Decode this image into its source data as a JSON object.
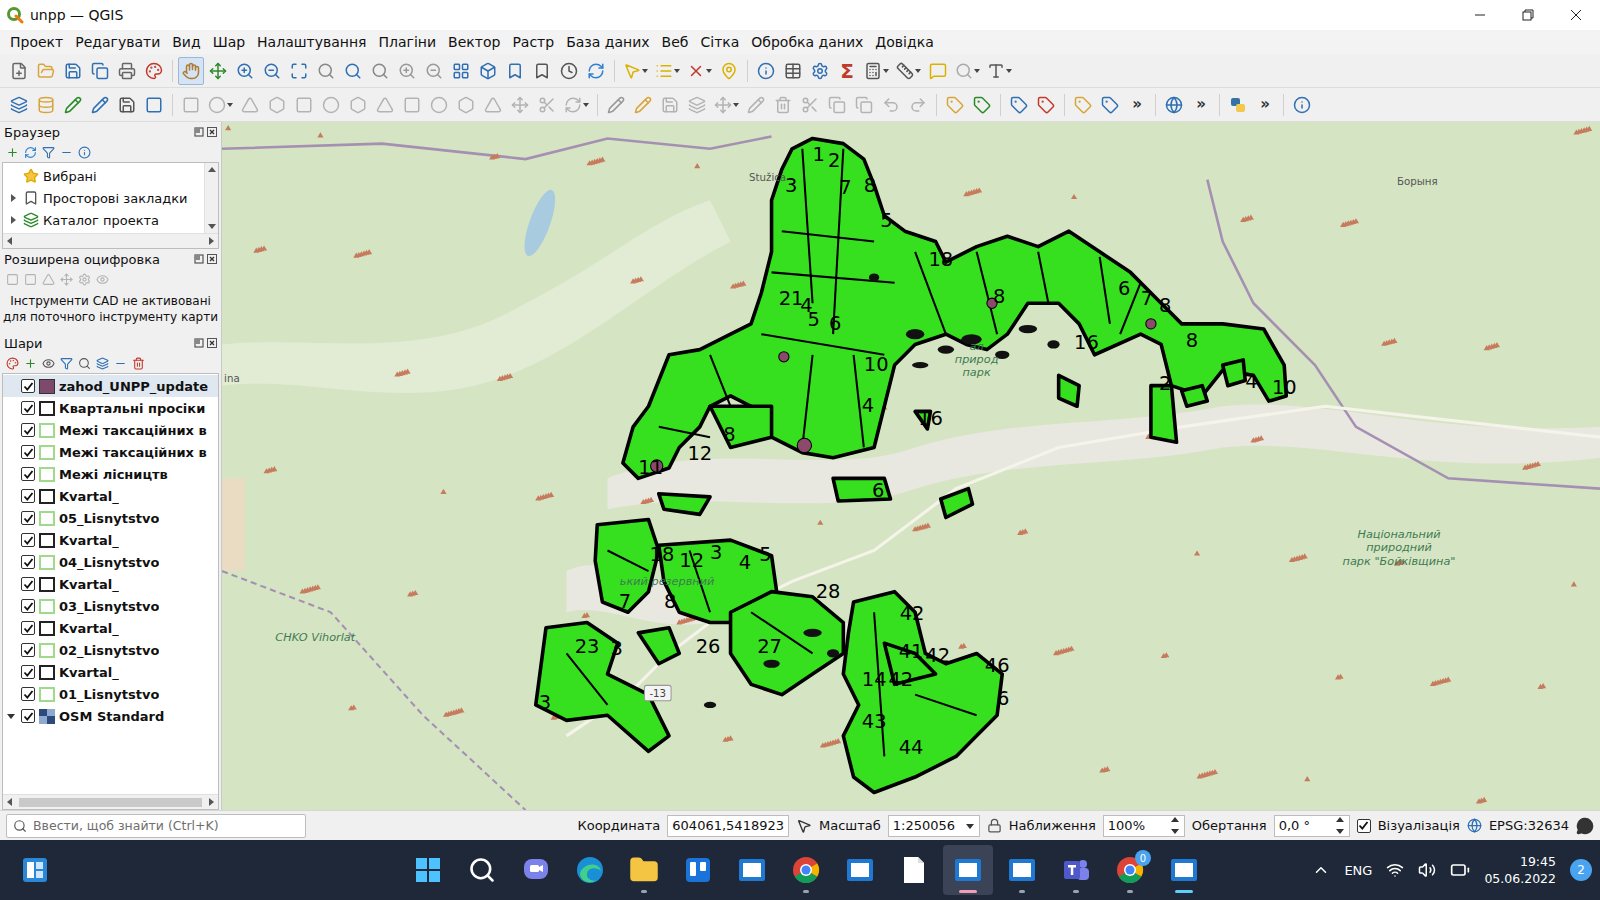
{
  "window": {
    "title": "unpp — QGIS"
  },
  "menu": [
    "Проект",
    "Редагувати",
    "Вид",
    "Шар",
    "Налаштування",
    "Плагіни",
    "Вектор",
    "Растр",
    "База даних",
    "Веб",
    "Сітка",
    "Обробка даних",
    "Довідка"
  ],
  "toolbar_1": {
    "pan_selected": true,
    "sigma": "Σ"
  },
  "toolbar_2": {
    "overflow": [
      "»",
      "»",
      "»"
    ]
  },
  "browser_panel": {
    "title": "Браузер",
    "items": [
      {
        "label": "Вибрані",
        "expandable": false,
        "expanded": false
      },
      {
        "label": "Просторові закладки",
        "expandable": true,
        "expanded": false
      },
      {
        "label": "Каталог проекта",
        "expandable": true,
        "expanded": false
      }
    ]
  },
  "digitizing_panel": {
    "title": "Розширена оцифровка",
    "message": "Інструменти CAD не активовані для поточного інструменту карти"
  },
  "layers_panel": {
    "title": "Шари",
    "layers": [
      {
        "name": "zahod_UNPP_update",
        "checked": true,
        "selected": true,
        "kind": "fill",
        "color": "#7d4a6c",
        "expandable": false,
        "expanded": false
      },
      {
        "name": "Квартальні просіки",
        "checked": true,
        "selected": false,
        "kind": "outline",
        "color": "#222222",
        "expandable": false,
        "expanded": false
      },
      {
        "name": "Межі таксаційних в",
        "checked": true,
        "selected": false,
        "kind": "outline",
        "color": "#9fd98a",
        "expandable": false,
        "expanded": false
      },
      {
        "name": "Межі таксаційних в",
        "checked": true,
        "selected": false,
        "kind": "outline",
        "color": "#9fd98a",
        "expandable": false,
        "expanded": false
      },
      {
        "name": "Межі лісництв",
        "checked": true,
        "selected": false,
        "kind": "outline",
        "color": "#9fd98a",
        "expandable": false,
        "expanded": false
      },
      {
        "name": "Kvartal_",
        "checked": true,
        "selected": false,
        "kind": "outline",
        "color": "#222222",
        "expandable": false,
        "expanded": false
      },
      {
        "name": "05_Lisnytstvo",
        "checked": true,
        "selected": false,
        "kind": "outline",
        "color": "#9fd98a",
        "expandable": false,
        "expanded": false
      },
      {
        "name": "Kvartal_",
        "checked": true,
        "selected": false,
        "kind": "outline",
        "color": "#222222",
        "expandable": false,
        "expanded": false
      },
      {
        "name": "04_Lisnytstvo",
        "checked": true,
        "selected": false,
        "kind": "outline",
        "color": "#9fd98a",
        "expandable": false,
        "expanded": false
      },
      {
        "name": "Kvartal_",
        "checked": true,
        "selected": false,
        "kind": "outline",
        "color": "#222222",
        "expandable": false,
        "expanded": false
      },
      {
        "name": "03_Lisnytstvo",
        "checked": true,
        "selected": false,
        "kind": "outline",
        "color": "#9fd98a",
        "expandable": false,
        "expanded": false
      },
      {
        "name": "Kvartal_",
        "checked": true,
        "selected": false,
        "kind": "outline",
        "color": "#222222",
        "expandable": false,
        "expanded": false
      },
      {
        "name": "02_Lisnytstvo",
        "checked": true,
        "selected": false,
        "kind": "outline",
        "color": "#9fd98a",
        "expandable": false,
        "expanded": false
      },
      {
        "name": "Kvartal_",
        "checked": true,
        "selected": false,
        "kind": "outline",
        "color": "#222222",
        "expandable": false,
        "expanded": false
      },
      {
        "name": "01_Lisnytstvo",
        "checked": true,
        "selected": false,
        "kind": "outline",
        "color": "#9fd98a",
        "expandable": false,
        "expanded": false
      },
      {
        "name": "OSM Standard",
        "checked": true,
        "selected": false,
        "kind": "raster",
        "color": "#2c4a7a",
        "expandable": true,
        "expanded": true
      }
    ]
  },
  "map": {
    "parcel_labels": [
      "1",
      "2",
      "3",
      "7",
      "8",
      "5",
      "18",
      "8",
      "6",
      "7",
      "8",
      "6",
      "4",
      "21",
      "5",
      "10",
      "10",
      "4",
      "2",
      "8",
      "16",
      "11",
      "12",
      "8",
      "4",
      "16",
      "6",
      "18",
      "12",
      "3",
      "4",
      "5",
      "28",
      "7",
      "8",
      "23",
      "3",
      "26",
      "27",
      "42",
      "41",
      "42",
      "46",
      "14",
      "42",
      "43",
      "44",
      "3",
      "6"
    ],
    "place_names": [
      {
        "kind": "place",
        "lines": [
          "Stužica"
        ]
      },
      {
        "kind": "place",
        "lines": [
          "Борыня"
        ]
      },
      {
        "kind": "park",
        "lines": [
          "Національний",
          "природний",
          "парк \"Бойківщина\""
        ]
      },
      {
        "kind": "park",
        "lines": [
          "CHKO Vihorlat"
        ]
      },
      {
        "kind": "place",
        "lines": [
          "ina"
        ]
      },
      {
        "kind": "park",
        "lines": [
          "ал",
          "природ",
          "парк"
        ]
      },
      {
        "kind": "park",
        "lines": [
          "ький резервний"
        ]
      },
      {
        "kind": "road",
        "lines": [
          "-13"
        ]
      }
    ]
  },
  "status_bar": {
    "search_placeholder": "Ввести, щоб знайти (Ctrl+K)",
    "coordinate_label": "Координата",
    "coordinate": "604061,5418923",
    "scale_label": "Масштаб",
    "scale": "1:250056",
    "scale_locked": false,
    "magnifier_label": "Наближення",
    "magnifier": "100%",
    "rotation_label": "Обертання",
    "rotation": "0,0 °",
    "render_label": "Візуалізація",
    "render_checked": true,
    "crs": "EPSG:32634"
  },
  "taskbar": {
    "apps": [
      {
        "kind": "start",
        "running": false,
        "selected": false,
        "attention": false,
        "badge": ""
      },
      {
        "kind": "search",
        "running": false,
        "selected": false,
        "attention": false,
        "badge": ""
      },
      {
        "kind": "chat",
        "running": false,
        "selected": false,
        "attention": false,
        "badge": ""
      },
      {
        "kind": "edge",
        "running": false,
        "selected": false,
        "attention": false,
        "badge": ""
      },
      {
        "kind": "explorer",
        "running": true,
        "selected": false,
        "attention": false,
        "badge": ""
      },
      {
        "kind": "trello",
        "running": false,
        "selected": false,
        "attention": false,
        "badge": ""
      },
      {
        "kind": "window",
        "running": false,
        "selected": false,
        "attention": false,
        "badge": ""
      },
      {
        "kind": "chrome",
        "running": true,
        "selected": false,
        "attention": false,
        "badge": ""
      },
      {
        "kind": "window",
        "running": false,
        "selected": false,
        "attention": false,
        "badge": ""
      },
      {
        "kind": "document",
        "running": false,
        "selected": false,
        "attention": false,
        "badge": ""
      },
      {
        "kind": "window",
        "running": true,
        "selected": false,
        "attention": true,
        "badge": ""
      },
      {
        "kind": "window",
        "running": true,
        "selected": false,
        "attention": false,
        "badge": ""
      },
      {
        "kind": "teams",
        "running": true,
        "selected": false,
        "attention": false,
        "badge": ""
      },
      {
        "kind": "chrome",
        "running": true,
        "selected": false,
        "attention": false,
        "badge": "0"
      },
      {
        "kind": "window",
        "running": true,
        "selected": true,
        "attention": false,
        "badge": ""
      }
    ],
    "language": "ENG",
    "time": "19:45",
    "date": "05.06.2022",
    "notifications": "2"
  }
}
